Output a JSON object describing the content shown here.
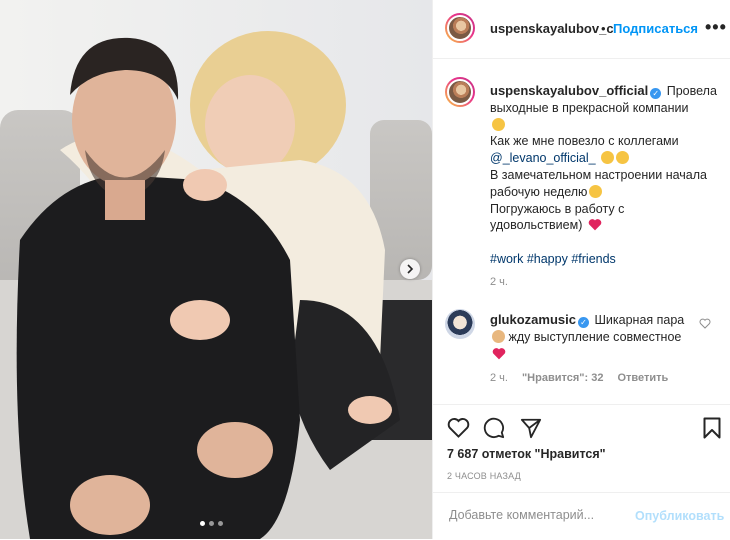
{
  "header": {
    "username": "uspenskayalubov_c",
    "separator": "•",
    "follow_label": "Подписаться",
    "more_label": "•••"
  },
  "caption": {
    "username": "uspenskayalubov_official",
    "line1": "Провела",
    "line2": "выходные в прекрасной компании",
    "line3": "Как же мне повезло с коллегами",
    "mention": "@_levano_official_",
    "line4": "В замечательном настроении начала",
    "line5": "рабочую неделю",
    "line6": "Погружаюсь в работу с",
    "line7": "удовольствием)",
    "hashtags": [
      "#work",
      "#happy",
      "#friends"
    ],
    "time": "2 ч."
  },
  "comment": {
    "username": "glukozamusic",
    "line1": "Шикарная пара",
    "line2": "жду выступление совместное",
    "time": "2 ч.",
    "likes": "\"Нравится\": 32",
    "reply": "Ответить"
  },
  "actions": {
    "likes_text": "7 687 отметок \"Нравится\"",
    "ago": "2 ЧАСОВ НАЗАД"
  },
  "add_comment": {
    "placeholder": "Добавьте комментарий...",
    "publish_label": "Опубликовать"
  },
  "carousel": {
    "total": 3,
    "active": 1
  },
  "colors": {
    "accent": "#0095f6",
    "link": "#00376b",
    "muted": "#8e8e8e",
    "heart": "#ed4956"
  }
}
